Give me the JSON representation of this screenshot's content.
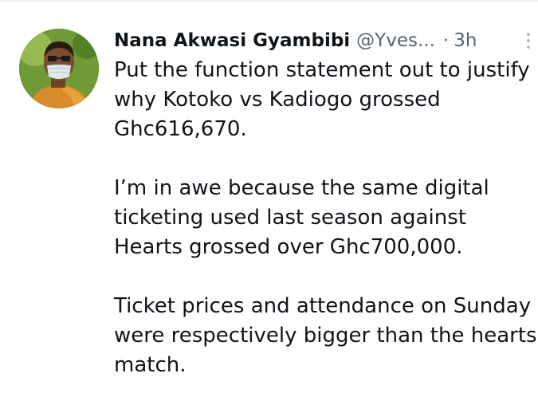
{
  "tweet": {
    "author_name": "Nana Akwasi Gyambibi",
    "author_handle": "@Yves...",
    "separator": "·",
    "time": "3h",
    "avatar_icon": "profile-photo",
    "more_icon": "more-vertical-icon",
    "paragraphs": [
      {
        "lines": [
          "Put the function statement out to justify",
          "why Kotoko vs Kadiogo grossed",
          "Ghc616,670."
        ]
      },
      {
        "lines": [
          "I’m in awe because the same digital",
          "ticketing used last season against",
          "Hearts grossed over Ghc700,000."
        ]
      },
      {
        "lines": [
          "Ticket prices and attendance on Sunday",
          "were respectively bigger than the hearts",
          "match."
        ]
      }
    ]
  }
}
